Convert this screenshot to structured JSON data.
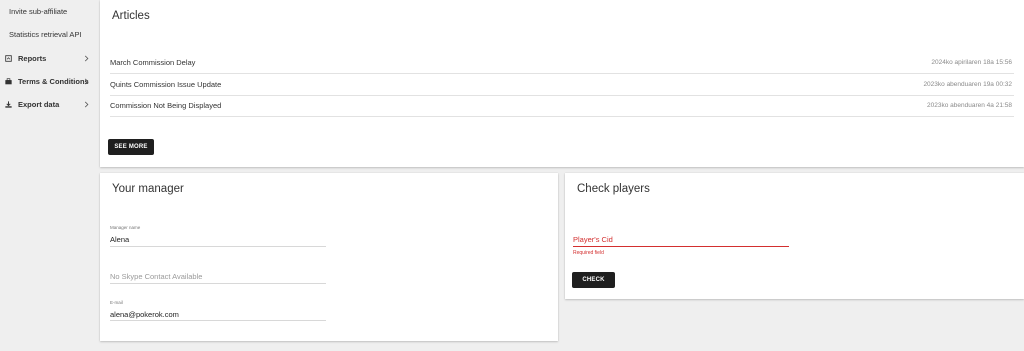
{
  "sidebar": {
    "links": [
      {
        "label": "Invite sub-affiliate"
      },
      {
        "label": "Statistics retrieval API"
      }
    ],
    "groups": [
      {
        "label": "Reports",
        "icon": "report-icon"
      },
      {
        "label": "Terms & Conditions",
        "icon": "briefcase-icon"
      },
      {
        "label": "Export data",
        "icon": "download-icon"
      }
    ]
  },
  "articles": {
    "title": "Articles",
    "items": [
      {
        "title": "March Commission Delay",
        "date": "2024ko apirilaren 18a 15:56"
      },
      {
        "title": "Quints Commission Issue Update",
        "date": "2023ko abenduaren 19a 00:32"
      },
      {
        "title": "Commission Not Being Displayed",
        "date": "2023ko abenduaren 4a 21:58"
      }
    ],
    "see_more_label": "SEE MORE"
  },
  "manager": {
    "title": "Your manager",
    "name_label": "Manager name",
    "name_value": "Alena",
    "skype_text": "No Skype Contact Available",
    "email_label": "E-mail",
    "email_value": "alena@pokerok.com"
  },
  "check_players": {
    "title": "Check players",
    "placeholder": "Player's Cid",
    "error": "Required field",
    "button_label": "CHECK"
  },
  "colors": {
    "background": "#efefef",
    "card": "#ffffff",
    "button": "#1f1f1f",
    "error": "#d32f2f"
  }
}
